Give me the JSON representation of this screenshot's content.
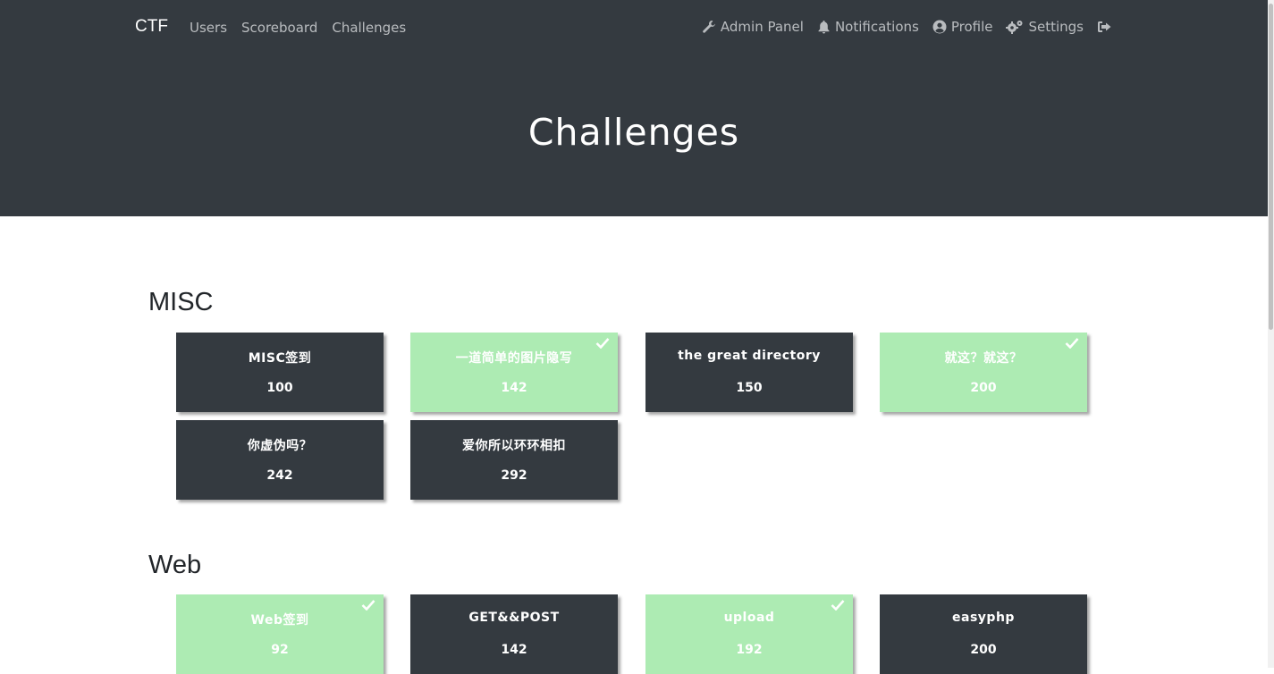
{
  "navbar": {
    "brand": "CTF",
    "links": [
      "Users",
      "Scoreboard",
      "Challenges"
    ],
    "admin_panel": "Admin Panel",
    "notifications": "Notifications",
    "profile": "Profile",
    "settings": "Settings",
    "logout_icon": "sign-out-icon"
  },
  "hero": {
    "title": "Challenges"
  },
  "categories": [
    {
      "name": "MISC",
      "challenges": [
        {
          "name": "MISC签到",
          "value": "100",
          "solved": false
        },
        {
          "name": "一道简单的图片隐写",
          "value": "142",
          "solved": true
        },
        {
          "name": "the great directory",
          "value": "150",
          "solved": false
        },
        {
          "name": "就这？就这？",
          "value": "200",
          "solved": true
        },
        {
          "name": "你虚伪吗？",
          "value": "242",
          "solved": false
        },
        {
          "name": "爱你所以环环相扣",
          "value": "292",
          "solved": false
        }
      ]
    },
    {
      "name": "Web",
      "challenges": [
        {
          "name": "Web签到",
          "value": "92",
          "solved": true
        },
        {
          "name": "GET&&POST",
          "value": "142",
          "solved": false
        },
        {
          "name": "upload",
          "value": "192",
          "solved": true
        },
        {
          "name": "easyphp",
          "value": "200",
          "solved": false
        }
      ]
    }
  ],
  "colors": {
    "navbar_bg": "#343a40",
    "card_unsolved": "#343a40",
    "card_solved": "#adebb3",
    "nav_text": "#b9bcbf"
  }
}
